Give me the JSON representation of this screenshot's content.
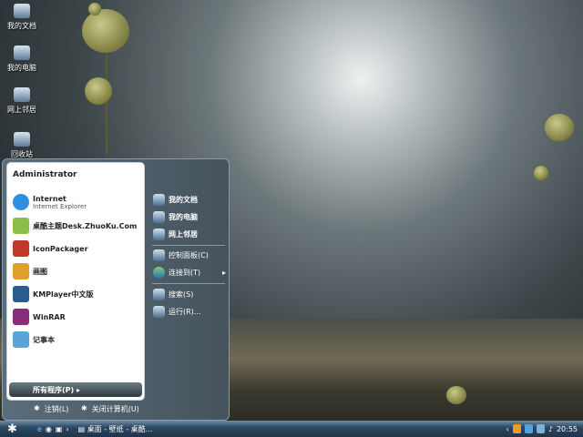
{
  "desktop": {
    "icons": [
      {
        "label": "我的文档"
      },
      {
        "label": "我的电脑"
      },
      {
        "label": "网上邻居"
      },
      {
        "label": "回收站"
      }
    ]
  },
  "start_menu": {
    "user": "Administrator",
    "programs": [
      {
        "label": "Internet",
        "sub": "Internet Explorer",
        "color": "#2f8ee0"
      },
      {
        "label": "桌酷主题Desk.ZhuoKu.Com",
        "color": "#8bbf4a"
      },
      {
        "label": "IconPackager",
        "color": "#c0392b"
      },
      {
        "label": "画图",
        "color": "#e0a030"
      },
      {
        "label": "KMPlayer中文版",
        "color": "#2a5d8f"
      },
      {
        "label": "WinRAR",
        "color": "#8a2c7c"
      },
      {
        "label": "记事本",
        "color": "#5ba4d8"
      }
    ],
    "all_programs": "所有程序(P)",
    "right": [
      {
        "label": "我的文档"
      },
      {
        "label": "我的电脑"
      },
      {
        "label": "网上邻居"
      },
      {
        "label": "控制面板(C)"
      },
      {
        "label": "连接到(T)"
      },
      {
        "label": "搜索(S)"
      },
      {
        "label": "运行(R)..."
      }
    ],
    "logoff": "注销(L)",
    "shutdown": "关闭计算机(U)"
  },
  "taskbar": {
    "task": "桌面 - 壁纸 - 桌酷...",
    "clock": "20:55"
  }
}
